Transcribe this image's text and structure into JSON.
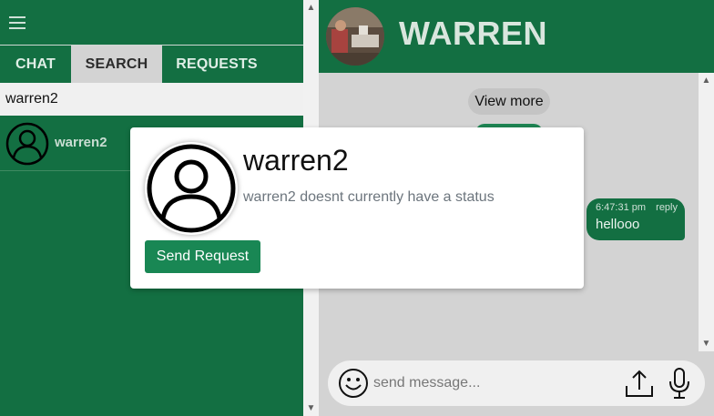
{
  "sidebar": {
    "tabs": [
      {
        "label": "CHAT"
      },
      {
        "label": "SEARCH"
      },
      {
        "label": "REQUESTS"
      }
    ],
    "search_value": "warren2",
    "results": [
      {
        "name": "warren2"
      }
    ]
  },
  "chat": {
    "contact_name": "WARREN",
    "view_more_label": "View more",
    "messages": [
      {
        "time": "6:47:31 pm",
        "reply_label": "reply",
        "text": "hellooo"
      }
    ],
    "input_placeholder": "send message..."
  },
  "modal": {
    "name": "warren2",
    "status": "warren2 doesnt currently have a status",
    "send_label": "Send Request"
  },
  "icons": {
    "menu": "hamburger-menu-icon",
    "avatar": "user-avatar-icon",
    "emoji": "smiley-icon",
    "upload": "upload-icon",
    "mic": "microphone-icon"
  },
  "colors": {
    "primary_green": "#136f42",
    "button_green": "#198754",
    "panel_gray": "#d3d3d3"
  }
}
